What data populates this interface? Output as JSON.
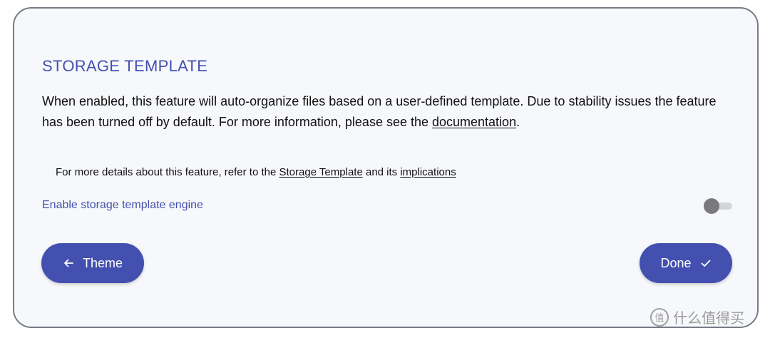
{
  "section": {
    "title": "STORAGE TEMPLATE",
    "description_main": "When enabled, this feature will auto-organize files based on a user-defined template. Due to stability issues the feature has been turned off by default. For more information, please see the ",
    "description_link": "documentation",
    "description_end": "."
  },
  "details": {
    "prefix": "For more details about this feature, refer to the ",
    "link_storage_template": "Storage Template",
    "middle": " and its ",
    "link_implications": "implications"
  },
  "toggle": {
    "label": "Enable storage template engine",
    "enabled": false
  },
  "buttons": {
    "back_label": "Theme",
    "done_label": "Done"
  },
  "icons": {
    "back": "arrow-left-icon",
    "done": "check-icon",
    "toggle": "toggle-switch"
  },
  "colors": {
    "accent": "#4350af",
    "card_background": "#f7f8fb",
    "card_border": "#767b86",
    "toggle_knob_off": "#7a7a7d",
    "toggle_track_off": "#d4d5d9"
  },
  "watermark": {
    "text": "什么值得买",
    "logo_glyph": "值"
  }
}
